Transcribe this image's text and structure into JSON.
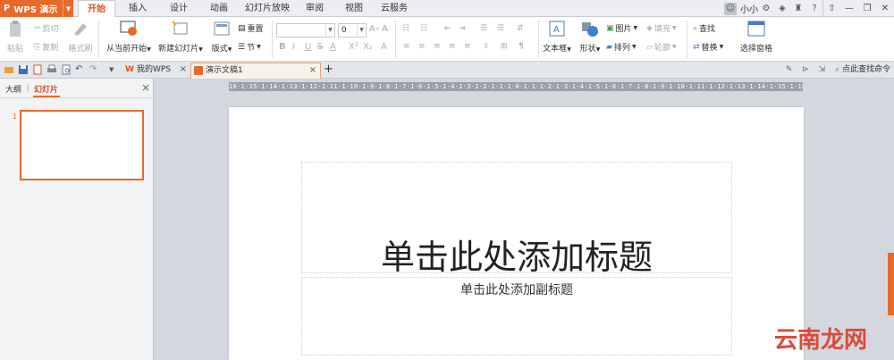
{
  "app": {
    "name": "WPS 演示"
  },
  "menu": {
    "tabs": [
      "开始",
      "插入",
      "设计",
      "动画",
      "幻灯片放映",
      "审阅",
      "视图",
      "云服务"
    ],
    "active_index": 0
  },
  "user": {
    "name": "小小"
  },
  "ribbon": {
    "paste": "粘贴",
    "cut": "剪切",
    "copy": "复制",
    "format_painter": "格式刷",
    "play_from_current": "从当前开始",
    "new_slide": "新建幻灯片",
    "layout": "版式",
    "section": "节",
    "reset": "重置",
    "font_size_value": "0",
    "textbox": "文本框",
    "shape": "形状",
    "picture": "图片",
    "fill": "填充",
    "arrange": "排列",
    "outline": "轮廓",
    "find": "查找",
    "replace": "替换",
    "selection_pane": "选择窗格"
  },
  "tabs": {
    "home": "我的WPS",
    "document": "演示文稿1",
    "new_tab": "+"
  },
  "search": {
    "label": "点此查找命令"
  },
  "left_panel": {
    "outline_tab": "大纲",
    "slides_tab": "幻灯片",
    "slide_number": "1"
  },
  "ruler": {
    "label": "16·1·15·1·14·1·13·1·12·1·11·1·10·1·9·1·8·1·7·1·6·1·5·1·4·1·3·1·2·1·1·1·0·1·1·1·2·1·3·1·4·1·5·1·6·1·7·1·8·1·9·1·10·1·11·1·12·1·13·1·14·1·15·1·16"
  },
  "slide": {
    "title_placeholder": "单击此处添加标题",
    "subtitle_placeholder": "单击此处添加副标题"
  },
  "watermark": {
    "text": "云南龙网"
  },
  "colors": {
    "accent": "#e8692a",
    "active_text": "#d9531e"
  }
}
